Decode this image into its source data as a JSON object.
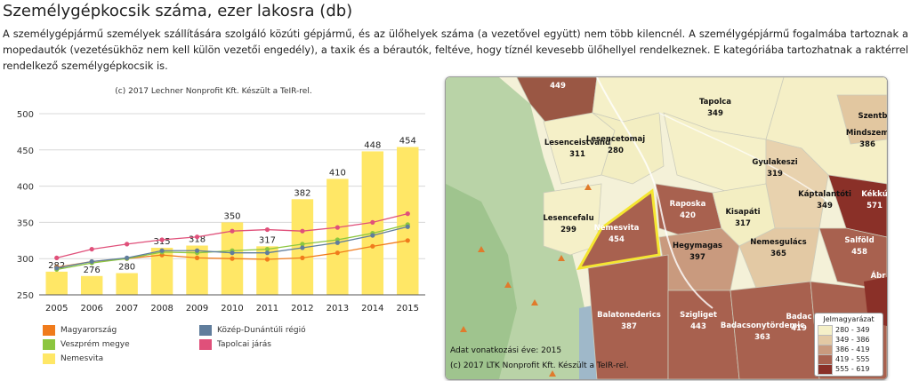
{
  "page": {
    "title": "Személygépkocsik száma, ezer lakosra (db)",
    "description": "A személygépjármű személyek szállítására szolgáló közúti gépjármű, és az ülőhelyek száma (a vezetővel együtt) nem több kilencnél. A személygépjármű fogalmába tartoznak a mopedautók (vezetésükhöz nem kell külön vezetői engedély), a taxik és a bérautók, feltéve, hogy tíznél kevesebb ülőhellyel rendelkeznek. E kategóriába tartozhatnak a raktérrel rendelkező személygépkocsik is."
  },
  "chart_data": {
    "type": "bar",
    "credit": "(c) 2017 Lechner Nonprofit Kft. Készült a TeIR-rel.",
    "categories": [
      "2005",
      "2006",
      "2007",
      "2008",
      "2009",
      "2010",
      "2011",
      "2012",
      "2013",
      "2014",
      "2015"
    ],
    "ylim": [
      250,
      500
    ],
    "yticks": [
      250,
      300,
      350,
      400,
      450,
      500
    ],
    "grid": true,
    "bar_series": {
      "name": "Nemesvita",
      "color": "#ffe766",
      "values": [
        282,
        276,
        280,
        315,
        318,
        350,
        317,
        382,
        410,
        448,
        454
      ]
    },
    "line_series": [
      {
        "name": "Magyarország",
        "color": "#f07b1c",
        "values": [
          288,
          296,
          300,
          305,
          301,
          300,
          299,
          301,
          308,
          317,
          325
        ]
      },
      {
        "name": "Veszprém megye",
        "color": "#8cc63f",
        "values": [
          285,
          294,
          300,
          309,
          308,
          311,
          313,
          320,
          326,
          335,
          347
        ]
      },
      {
        "name": "Közép-Dunántúli régió",
        "color": "#607d9c",
        "values": [
          287,
          296,
          301,
          311,
          311,
          308,
          308,
          315,
          322,
          332,
          344
        ]
      },
      {
        "name": "Tapolcai járás",
        "color": "#e0507a",
        "values": [
          301,
          313,
          320,
          326,
          330,
          338,
          340,
          338,
          343,
          350,
          362
        ]
      }
    ],
    "legend": [
      {
        "name": "Magyarország",
        "color": "#f07b1c"
      },
      {
        "name": "Közép-Dunántúli régió",
        "color": "#607d9c"
      },
      {
        "name": "Veszprém megye",
        "color": "#8cc63f"
      },
      {
        "name": "Tapolcai járás",
        "color": "#e0507a"
      },
      {
        "name": "Nemesvita",
        "color": "#ffe766"
      }
    ]
  },
  "map": {
    "places": [
      {
        "name": "",
        "value": "449",
        "dark": true
      },
      {
        "name": "Tapolca",
        "value": "349",
        "dark": false
      },
      {
        "name": "Szentb",
        "value": "",
        "dark": false
      },
      {
        "name": "Mindszem",
        "value": "386",
        "dark": false
      },
      {
        "name": "Lesenceistvánd",
        "value": "311",
        "dark": false
      },
      {
        "name": "Lesencetomaj",
        "value": "280",
        "dark": false
      },
      {
        "name": "Gyulakeszi",
        "value": "319",
        "dark": false
      },
      {
        "name": "Káptalantóti",
        "value": "349",
        "dark": false
      },
      {
        "name": "Kékkú",
        "value": "571",
        "dark": true
      },
      {
        "name": "Raposka",
        "value": "420",
        "dark": true
      },
      {
        "name": "Lesencefalu",
        "value": "299",
        "dark": false
      },
      {
        "name": "Nemesvita",
        "value": "454",
        "dark": false
      },
      {
        "name": "Kisapáti",
        "value": "317",
        "dark": false
      },
      {
        "name": "Hegymagas",
        "value": "397",
        "dark": false
      },
      {
        "name": "Nemesgulács",
        "value": "365",
        "dark": false
      },
      {
        "name": "Salföld",
        "value": "458",
        "dark": true
      },
      {
        "name": "Ábr",
        "value": "",
        "dark": true
      },
      {
        "name": "Balatonederics",
        "value": "387",
        "dark": true
      },
      {
        "name": "Szigliget",
        "value": "443",
        "dark": true
      },
      {
        "name": "Badacsonytördemic",
        "value": "363",
        "dark": true
      },
      {
        "name": "Badac",
        "value": "419",
        "dark": true
      }
    ],
    "background_labels": [
      "Tapolca",
      "Balatonederics",
      "Badacsonytördemic"
    ],
    "year_label": "Adat vonatkozási éve: 2015",
    "credit": "(c) 2017 LTK Nonprofit Kft. Készült a TeIR-rel.",
    "legend_title": "Jelmagyarázat",
    "legend": [
      {
        "range": "280 - 349",
        "color": "#f5f0c8"
      },
      {
        "range": "349 - 386",
        "color": "#e3c9a4"
      },
      {
        "range": "386 - 419",
        "color": "#c99a7e"
      },
      {
        "range": "419 - 555",
        "color": "#a8614f"
      },
      {
        "range": "555 - 619",
        "color": "#8a3028"
      }
    ]
  }
}
